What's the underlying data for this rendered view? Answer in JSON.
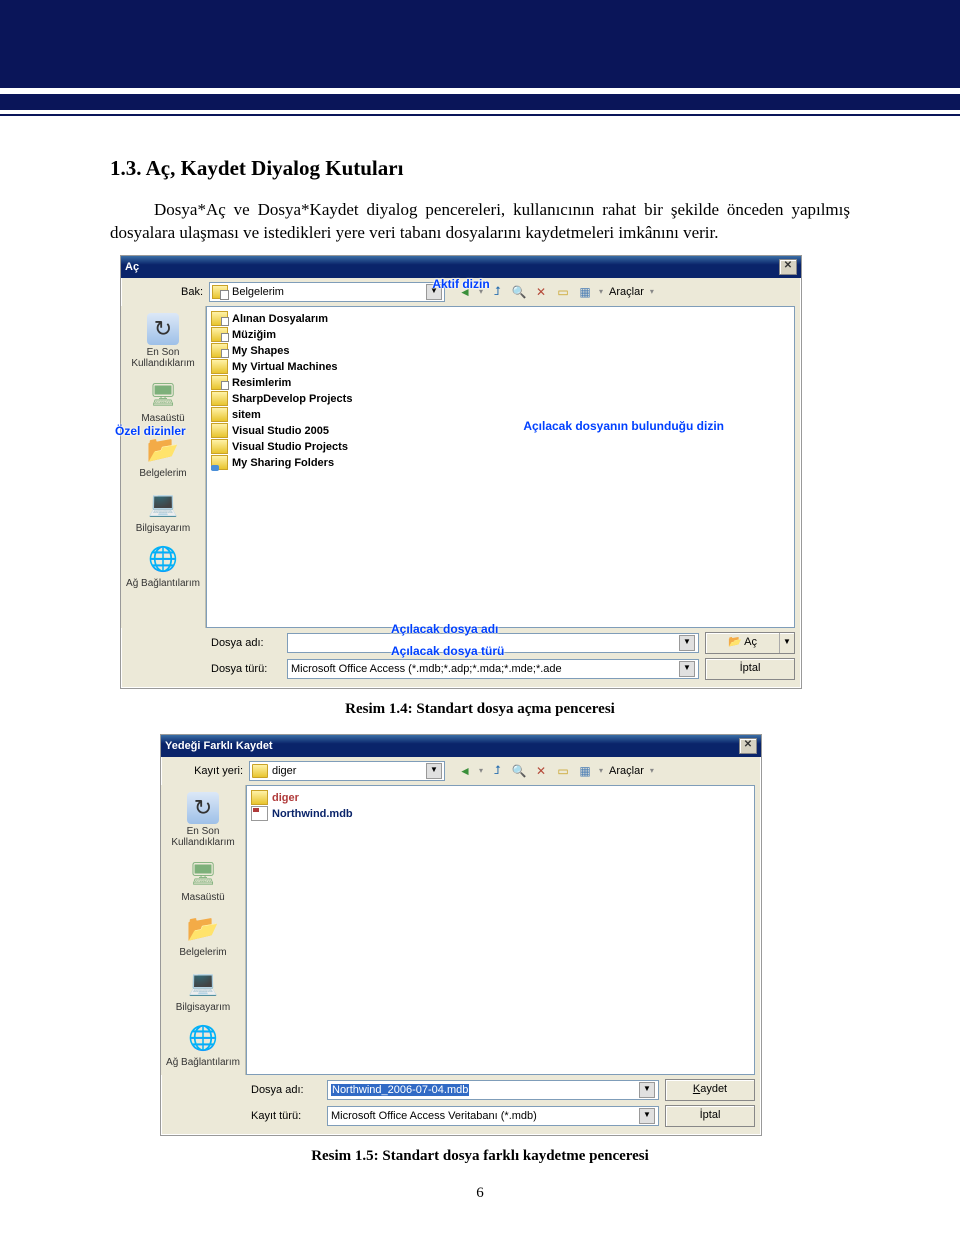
{
  "doc": {
    "heading": "1.3. Aç, Kaydet Diyalog Kutuları",
    "paragraph": "Dosya*Aç ve Dosya*Kaydet diyalog pencereleri, kullanıcının rahat bir şekilde önceden yapılmış dosyalara ulaşması ve istedikleri yere veri tabanı dosyalarını kaydetmeleri imkânını verir.",
    "caption1": "Resim 1.4: Standart dosya açma penceresi",
    "caption2": "Resim 1.5: Standart dosya farklı kaydetme penceresi",
    "pagenum": "6"
  },
  "dlg1": {
    "title": "Aç",
    "lookin_label": "Bak:",
    "lookin_value": "Belgelerim",
    "tools_label": "Araçlar",
    "places": [
      {
        "label": "En Son Kullandıklarım",
        "icon": "recent"
      },
      {
        "label": "Masaüstü",
        "icon": "desktop"
      },
      {
        "label": "Belgelerim",
        "icon": "mydocs"
      },
      {
        "label": "Bilgisayarım",
        "icon": "mypc"
      },
      {
        "label": "Ağ Bağlantılarım",
        "icon": "network"
      }
    ],
    "items": [
      {
        "icon": "folddoc",
        "name": "Alınan Dosyalarım"
      },
      {
        "icon": "folddoc",
        "name": "Müziğim"
      },
      {
        "icon": "folddoc",
        "name": "My Shapes"
      },
      {
        "icon": "fold",
        "name": "My Virtual Machines"
      },
      {
        "icon": "folddoc",
        "name": "Resimlerim"
      },
      {
        "icon": "fold",
        "name": "SharpDevelop Projects"
      },
      {
        "icon": "fold",
        "name": "sitem"
      },
      {
        "icon": "fold",
        "name": "Visual Studio 2005"
      },
      {
        "icon": "fold",
        "name": "Visual Studio Projects"
      },
      {
        "icon": "share",
        "name": "My Sharing Folders"
      }
    ],
    "filename_label": "Dosya adı:",
    "filename_value": "",
    "filetype_label": "Dosya türü:",
    "filetype_value": "Microsoft Office Access (*.mdb;*.adp;*.mda;*.mde;*.ade",
    "open_btn": "Aç",
    "cancel_btn": "İptal",
    "annot_aktif": "Aktif dizin",
    "annot_dizin": "Özel dizinler",
    "annot_right": "Açılacak dosyanın bulunduğu dizin",
    "annot_name": "Açılacak dosya adı",
    "annot_type": "Açılacak dosya türü"
  },
  "dlg2": {
    "title": "Yedeği Farklı Kaydet",
    "lookin_label": "Kayıt yeri:",
    "lookin_value": "diger",
    "tools_label": "Araçlar",
    "places": [
      {
        "label": "En Son Kullandıklarım",
        "icon": "recent"
      },
      {
        "label": "Masaüstü",
        "icon": "desktop"
      },
      {
        "label": "Belgelerim",
        "icon": "mydocs"
      },
      {
        "label": "Bilgisayarım",
        "icon": "mypc"
      },
      {
        "label": "Ağ Bağlantılarım",
        "icon": "network"
      }
    ],
    "items": [
      {
        "icon": "fold",
        "name": "diger",
        "bold": true,
        "color": "#b03a3a"
      },
      {
        "icon": "mdb",
        "name": "Northwind.mdb",
        "color": "#0a246a"
      }
    ],
    "filename_label": "Dosya adı:",
    "filename_value": "Northwind_2006-07-04.mdb",
    "filetype_label": "Kayıt türü:",
    "filetype_value": "Microsoft Office Access Veritabanı (*.mdb)",
    "save_btn": "Kaydet",
    "cancel_btn": "İptal"
  }
}
